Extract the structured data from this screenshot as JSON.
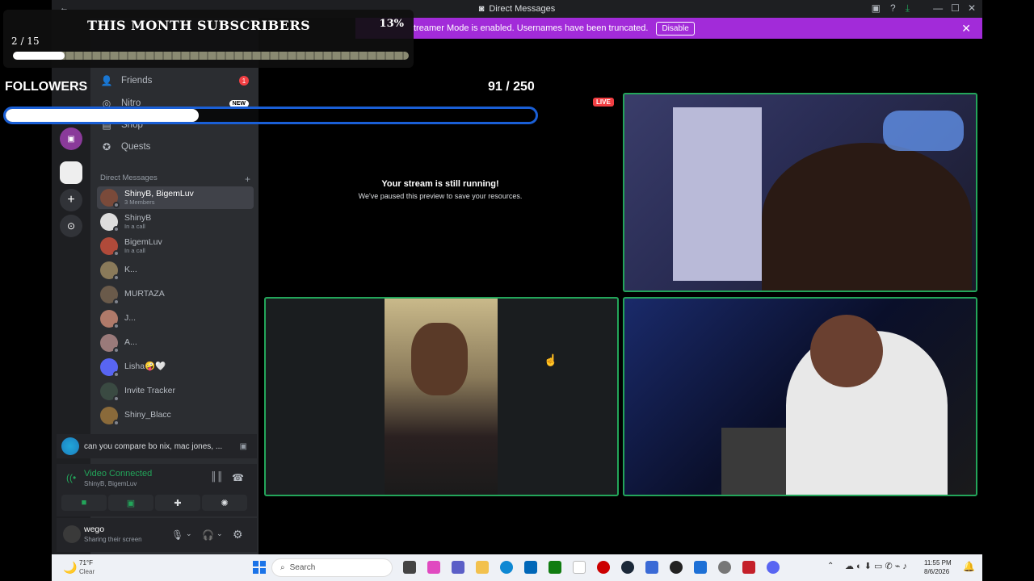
{
  "window": {
    "title": "Direct Messages"
  },
  "banner": {
    "text": "treamer Mode is enabled. Usernames have been truncated.",
    "disable_label": "Disable"
  },
  "overlay": {
    "subs_title": "THIS MONTH SUBSCRIBERS",
    "subs_percent": "13%",
    "subs_count": "2 / 15",
    "subs_progress": 0.13,
    "followers_label": "FOLLOWERS",
    "followers_count": "91 / 250",
    "followers_progress": 0.364
  },
  "sidebar": {
    "nav": [
      {
        "label": "Friends",
        "icon": "friends-icon",
        "badge": "1"
      },
      {
        "label": "Nitro",
        "icon": "nitro-icon",
        "badge": "NEW"
      },
      {
        "label": "Shop",
        "icon": "shop-icon"
      },
      {
        "label": "Quests",
        "icon": "quests-icon"
      }
    ],
    "dm_header": "Direct Messages",
    "dms": [
      {
        "name": "ShinyB, BigemLuv",
        "sub": "3 Members",
        "color": "#7a4a3a",
        "active": true
      },
      {
        "name": "ShinyB",
        "sub": "In a call",
        "color": "#ddd"
      },
      {
        "name": "BigemLuv",
        "sub": "In a call",
        "color": "#b04a3a"
      },
      {
        "name": "K...",
        "sub": "",
        "color": "#8a7a5a"
      },
      {
        "name": "MURTAZA",
        "sub": "",
        "color": "#6a5a4a"
      },
      {
        "name": "J...",
        "sub": "",
        "color": "#b07a6a"
      },
      {
        "name": "A...",
        "sub": "",
        "color": "#9a7a7a"
      },
      {
        "name": "Lisha🤪🤍",
        "sub": "",
        "color": "#5865f2"
      },
      {
        "name": "Invite Tracker",
        "sub": "",
        "color": "#3a4a42"
      },
      {
        "name": "Shiny_Blacc",
        "sub": "",
        "color": "#8a6a3a"
      }
    ]
  },
  "activity": {
    "text": "can you compare bo nix, mac jones, ..."
  },
  "voice": {
    "status": "Video Connected",
    "channel": "ShinyB, BigemLuv"
  },
  "user": {
    "name": "wego",
    "status": "Sharing their screen"
  },
  "stream": {
    "live_label": "LIVE",
    "paused_title": "Your stream is still running!",
    "paused_sub": "We've paused this preview to save your resources."
  },
  "taskbar": {
    "weather_temp": "71°F",
    "weather_desc": "Clear",
    "search_placeholder": "Search",
    "time": "11:55 PM",
    "date": "8/6/2026"
  }
}
